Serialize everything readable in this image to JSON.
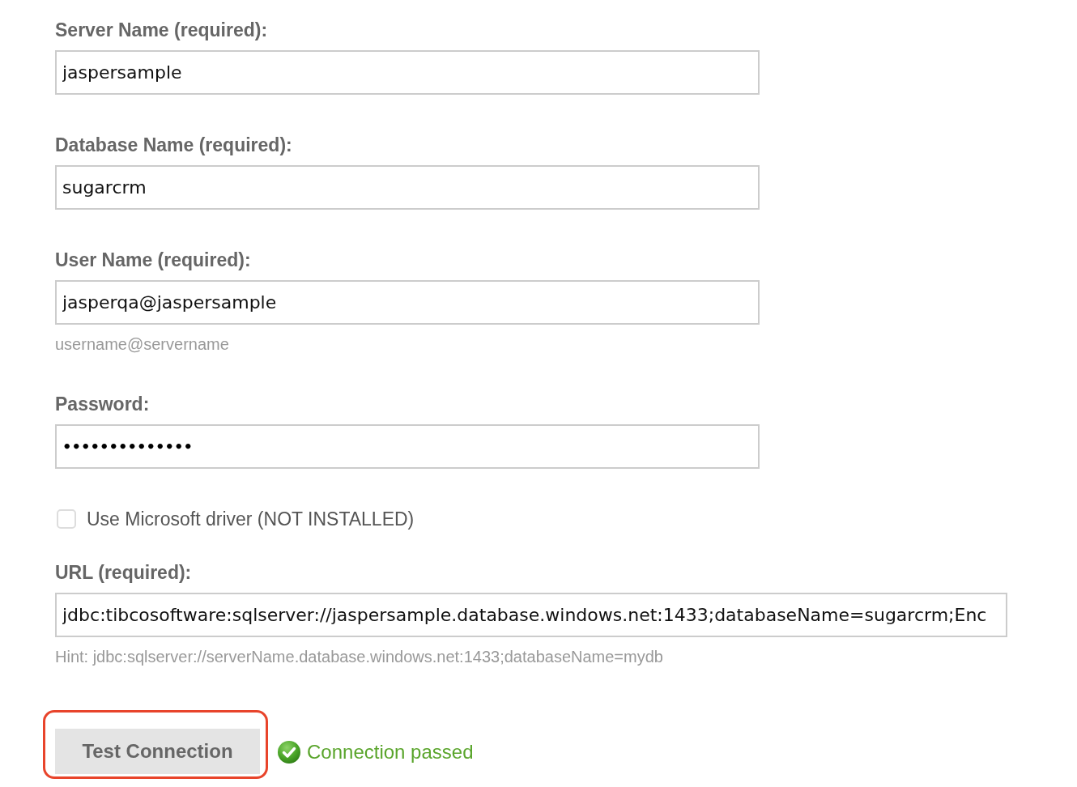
{
  "fields": [
    {
      "kind": "text",
      "label": "Server Name (required):",
      "value": "jaspersample"
    },
    {
      "kind": "text",
      "label": "Database Name (required):",
      "value": "sugarcrm"
    },
    {
      "kind": "text",
      "label": "User Name (required):",
      "value": "jasperqa@jaspersample",
      "hint": "username@servername"
    },
    {
      "kind": "password",
      "label": "Password:",
      "value": "••••••••••••••"
    },
    {
      "kind": "checkbox",
      "label": "Use Microsoft driver (NOT INSTALLED)",
      "checked": false
    },
    {
      "kind": "url",
      "label": "URL (required):",
      "value": "jdbc:tibcosoftware:sqlserver://jaspersample.database.windows.net:1433;databaseName=sugarcrm;Enc",
      "hint": "Hint: jdbc:sqlserver://serverName.database.windows.net:1433;databaseName=mydb"
    }
  ],
  "test_button": {
    "label": "Test Connection",
    "highlighted": true
  },
  "status": {
    "text": "Connection passed",
    "passed": true
  }
}
